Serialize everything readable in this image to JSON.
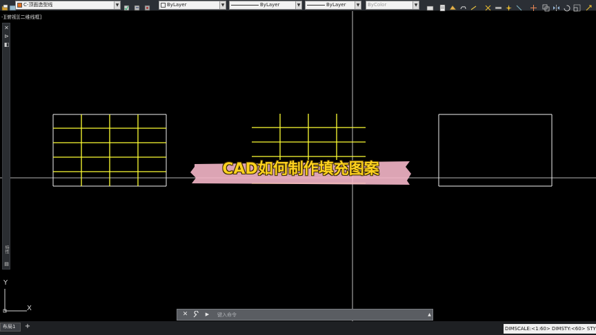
{
  "toolbar": {
    "layer_combo": "C-顶面造型线",
    "color_combo": "ByLayer",
    "linetype_combo": "ByLayer",
    "lineweight_combo": "ByLayer",
    "plotstyle_combo": "ByColor",
    "layer_color": "#e07020",
    "color_swatch": "#f0f0f0"
  },
  "viewport": {
    "label": "-][俯视][二维线框]"
  },
  "left_palette": {
    "close_glyph": "✕",
    "pin_glyph": "⊳",
    "props_glyph": "◧",
    "bottom_label": "特性"
  },
  "ucs": {
    "y_label": "Y",
    "x_label": "X"
  },
  "command": {
    "placeholder": "键入命令",
    "close_glyph": "✕",
    "wrench_glyph": "🔧",
    "recent_glyph": "▶",
    "scroll_glyph": "▲"
  },
  "layout_tabs": {
    "tabs": [
      "布局1"
    ],
    "add_glyph": "+"
  },
  "status_bar": {
    "text": "DIMSCALE:<1:60> DIMSTY:<60> STY"
  },
  "caption": {
    "text": "CAD如何制作填充图案"
  },
  "colors": {
    "canvas_bg": "#000000",
    "hatch_yellow": "#ffff33",
    "rect_white": "#f2f2f2",
    "caption_tape": "#f4b6c8",
    "caption_text": "#ffd21f"
  }
}
